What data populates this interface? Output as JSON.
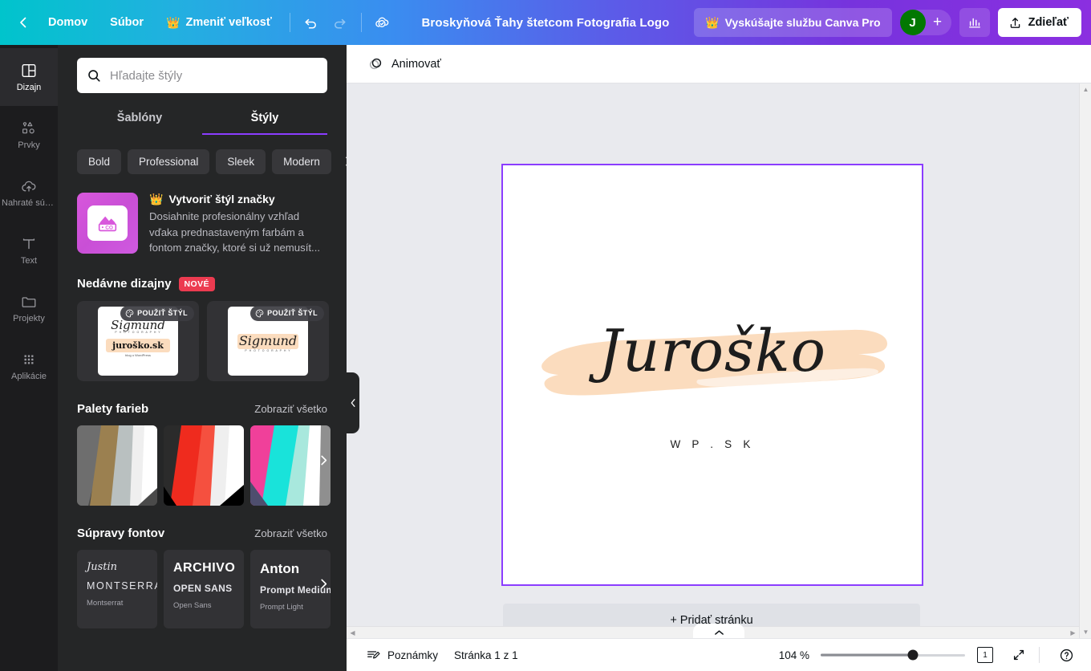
{
  "topbar": {
    "back_icon": "chevron-left-icon",
    "home_label": "Domov",
    "file_label": "Súbor",
    "resize_label": "Zmeniť veľkosť",
    "resize_icon": "crown-icon",
    "undo_icon": "undo-icon",
    "redo_icon": "redo-icon",
    "cloud_icon": "cloud-saved-icon",
    "title": "Broskyňová Ťahy štetcom Fotografia Logo",
    "pro_label": "Vyskúšajte službu Canva Pro",
    "pro_icon": "crown-icon",
    "avatar_initial": "J",
    "avatar_plus": "+",
    "stats_icon": "bar-chart-icon",
    "share_label": "Zdieľať",
    "share_icon": "share-upload-icon"
  },
  "rail": {
    "items": [
      {
        "label": "Dizajn",
        "icon": "layout-icon",
        "active": true
      },
      {
        "label": "Prvky",
        "icon": "shapes-icon",
        "active": false
      },
      {
        "label": "Nahraté súb...",
        "icon": "upload-cloud-icon",
        "active": false
      },
      {
        "label": "Text",
        "icon": "text-t-icon",
        "active": false
      },
      {
        "label": "Projekty",
        "icon": "folder-icon",
        "active": false
      },
      {
        "label": "Aplikácie",
        "icon": "grid-dots-icon",
        "active": false
      }
    ]
  },
  "panel": {
    "search": {
      "placeholder": "Hľadajte štýly",
      "value": "",
      "icon": "search-icon"
    },
    "tabs": [
      {
        "label": "Šablóny",
        "active": false
      },
      {
        "label": "Štýly",
        "active": true
      }
    ],
    "chips": [
      "Bold",
      "Professional",
      "Sleek",
      "Modern"
    ],
    "chips_next_icon": "chevron-right-icon",
    "promo": {
      "icon": "brand-kit-icon",
      "crown": "crown-icon",
      "title": "Vytvoriť štýl značky",
      "description": "Dosiahnite profesionálny vzhľad vďaka prednastaveným farbám a fontom značky, ktoré si už nemusít..."
    },
    "recent": {
      "title": "Nedávne dizajny",
      "badge": "NOVÉ",
      "cards": [
        {
          "use_style_label": "POUŽIŤ ŠTÝL",
          "icon": "palette-icon",
          "line1": "Sigmund",
          "line2": "juroško.sk"
        },
        {
          "use_style_label": "POUŽIŤ ŠTÝL",
          "icon": "palette-icon",
          "line1": "Sigmund",
          "line2": ""
        }
      ]
    },
    "palettes": {
      "title": "Palety farieb",
      "link": "Zobraziť všetko",
      "next_icon": "chevron-right-icon",
      "items": [
        {
          "colors": [
            "#4a4a4a",
            "#6e6e6e",
            "#9b8050",
            "#b9c0c0",
            "#efefef",
            "#ffffff",
            "#4a4a4a"
          ]
        },
        {
          "colors": [
            "#2b2b2b",
            "#ef2b1e",
            "#f5503f",
            "#efefef",
            "#ffffff",
            "#000000"
          ]
        },
        {
          "colors": [
            "#4e4e6e",
            "#f0409a",
            "#19e3da",
            "#a8e8dd",
            "#ffffff",
            "#8f8f8f"
          ]
        }
      ]
    },
    "fonts": {
      "title": "Súpravy fontov",
      "link": "Zobraziť všetko",
      "next_icon": "chevron-right-icon",
      "items": [
        {
          "script": "Justin",
          "display": "MONTSERRAT",
          "caption": "Montserrat"
        },
        {
          "script": "",
          "display_big": "ARCHIVO",
          "display": "OPEN SANS",
          "caption": "Open Sans"
        },
        {
          "script": "",
          "display_big": "Anton",
          "display": "Prompt Medium",
          "caption": "Prompt Light"
        }
      ]
    },
    "collapse_icon": "chevron-left-icon"
  },
  "editor": {
    "animate_label": "Animovať",
    "animate_icon": "animate-circles-icon",
    "canvas_tools": [
      {
        "icon": "lock-icon",
        "name": "lock-page-button"
      },
      {
        "icon": "duplicate-icon",
        "name": "duplicate-page-button"
      },
      {
        "icon": "add-page-icon",
        "name": "add-page-button"
      }
    ],
    "comment_icon": "comment-add-icon",
    "add_page_label": "+ Pridať stránku",
    "collapse_icon": "chevron-up-icon",
    "design": {
      "logo_text": "Juroško",
      "sub_text": "W P . S K",
      "brush_color": "#fbdcbe",
      "text_color": "#1d1d1d",
      "page_border_color": "#8b3dff"
    }
  },
  "statusbar": {
    "notes_label": "Poznámky",
    "notes_icon": "notes-icon",
    "page_label": "Stránka 1 z 1",
    "zoom_value": "104 %",
    "zoom_percent": 64,
    "pages_count": "1",
    "pages_icon": "page-stack-icon",
    "fullscreen_icon": "expand-icon",
    "help_icon": "help-circle-icon"
  }
}
